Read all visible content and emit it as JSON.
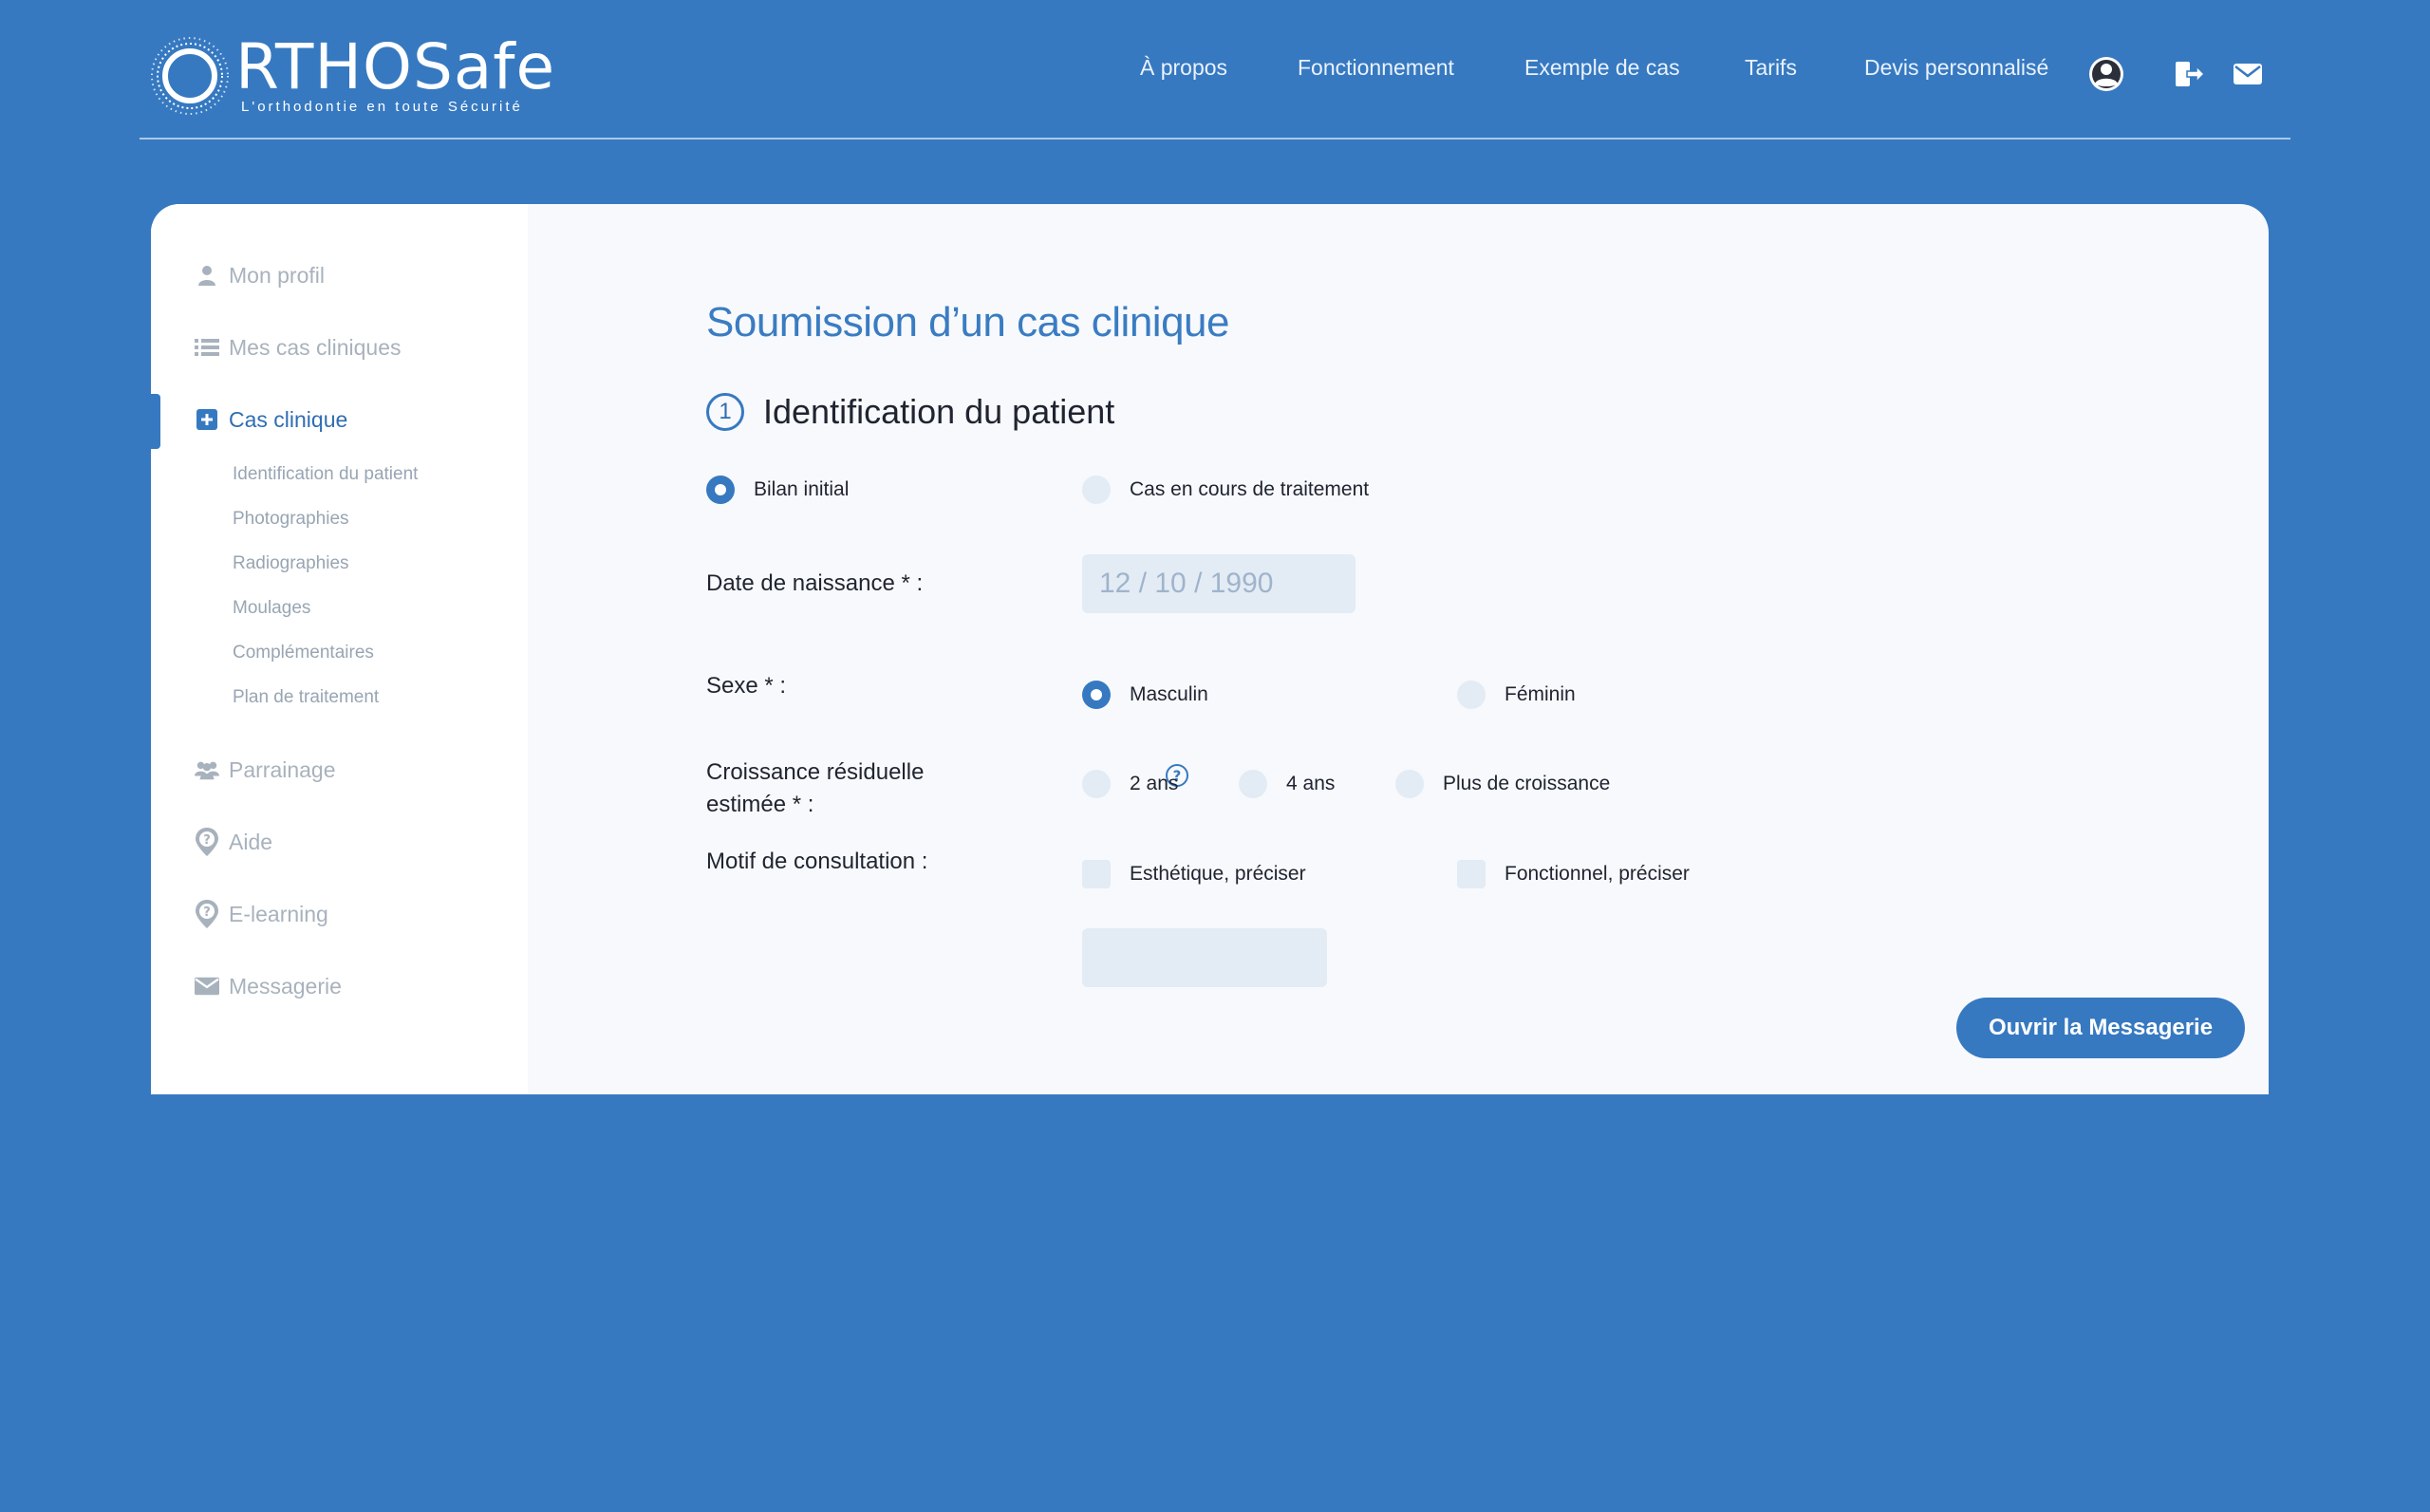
{
  "header": {
    "logo_word": "RTHOSafe",
    "logo_tagline": "L'orthodontie en toute Sécurité",
    "nav": [
      {
        "label": "À propos"
      },
      {
        "label": "Fonctionnement"
      },
      {
        "label": "Exemple de cas"
      },
      {
        "label": "Tarifs"
      },
      {
        "label": "Devis personnalisé"
      }
    ],
    "icons": [
      "user-account-icon",
      "logout-icon",
      "mail-icon"
    ]
  },
  "sidebar": {
    "items": [
      {
        "label": "Mon profil",
        "icon": "user-icon"
      },
      {
        "label": "Mes cas cliniques",
        "icon": "list-icon"
      },
      {
        "label": "Cas clinique",
        "icon": "plus-square-icon",
        "active": true
      },
      {
        "label": "Parrainage",
        "icon": "group-icon"
      },
      {
        "label": "Aide",
        "icon": "help-pin-icon"
      },
      {
        "label": "E-learning",
        "icon": "help-pin-icon"
      },
      {
        "label": "Messagerie",
        "icon": "mail-icon"
      }
    ],
    "sub_items": [
      {
        "label": "Identification du patient"
      },
      {
        "label": "Photographies"
      },
      {
        "label": "Radiographies"
      },
      {
        "label": "Moulages"
      },
      {
        "label": "Complémentaires"
      },
      {
        "label": "Plan de traitement"
      }
    ]
  },
  "main": {
    "title": "Soumission d’un cas clinique",
    "step_number": "1",
    "step_title": "Identification du patient",
    "bilan": {
      "options": [
        {
          "label": "Bilan initial",
          "selected": true
        },
        {
          "label": "Cas en cours de traitement",
          "selected": false
        }
      ]
    },
    "dob": {
      "label": "Date de naissance * :",
      "placeholder": "12 / 10 / 1990"
    },
    "sexe": {
      "label": "Sexe * :",
      "options": [
        {
          "label": "Masculin",
          "selected": true
        },
        {
          "label": "Féminin",
          "selected": false
        }
      ]
    },
    "croissance": {
      "label_line1": "Croissance résiduelle",
      "label_line2": "estimée * :",
      "options": [
        {
          "label": "2 ans",
          "selected": false
        },
        {
          "label": "4 ans",
          "selected": false
        },
        {
          "label": "Plus de croissance",
          "selected": false
        }
      ]
    },
    "motif": {
      "label": "Motif de consultation :",
      "options": [
        {
          "label": "Esthétique, préciser",
          "checked": false
        },
        {
          "label": "Fonctionnel, préciser",
          "checked": false
        }
      ],
      "detail_value": ""
    },
    "cta_label": "Ouvrir la Messagerie"
  },
  "colors": {
    "brand_blue": "#3679c1",
    "title_blue": "#3a7cc2",
    "field_bg": "#e3ebf4",
    "sidebar_muted": "#a8b2bd"
  }
}
